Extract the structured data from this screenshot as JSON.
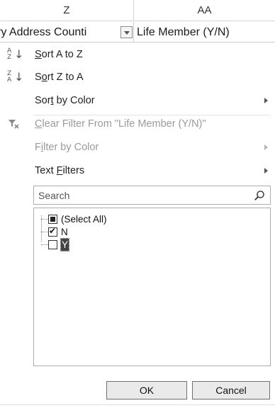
{
  "columns": {
    "z": "Z",
    "aa": "AA"
  },
  "fields": {
    "left": "ry Address Counti",
    "right": "Life Member (Y/N)"
  },
  "menu": {
    "sort_az": {
      "pre": "",
      "key": "S",
      "post": "ort A to Z"
    },
    "sort_za": {
      "pre": "S",
      "key": "o",
      "post": "rt Z to A"
    },
    "sort_color": {
      "pre": "Sor",
      "key": "t",
      "post": " by Color"
    },
    "clear_filter": {
      "pre": "",
      "key": "C",
      "post": "lear Filter From \"Life Member (Y/N)\""
    },
    "filter_color": {
      "pre": "F",
      "key": "i",
      "post": "lter by Color"
    },
    "text_filters": {
      "pre": "Text ",
      "key": "F",
      "post": "ilters"
    }
  },
  "search": {
    "placeholder": "Search"
  },
  "list": {
    "items": [
      {
        "label": "(Select All)",
        "state": "partial"
      },
      {
        "label": "N",
        "state": "checked"
      },
      {
        "label": "Y",
        "state": "unchecked"
      }
    ]
  },
  "buttons": {
    "ok": "OK",
    "cancel": "Cancel"
  },
  "icons": {
    "sort_asc": "sort-ascending-icon",
    "sort_desc": "sort-descending-icon",
    "clear_filter": "clear-filter-icon",
    "search": "search-icon",
    "submenu": "chevron-right-icon",
    "dropdown": "dropdown-arrow-icon"
  }
}
